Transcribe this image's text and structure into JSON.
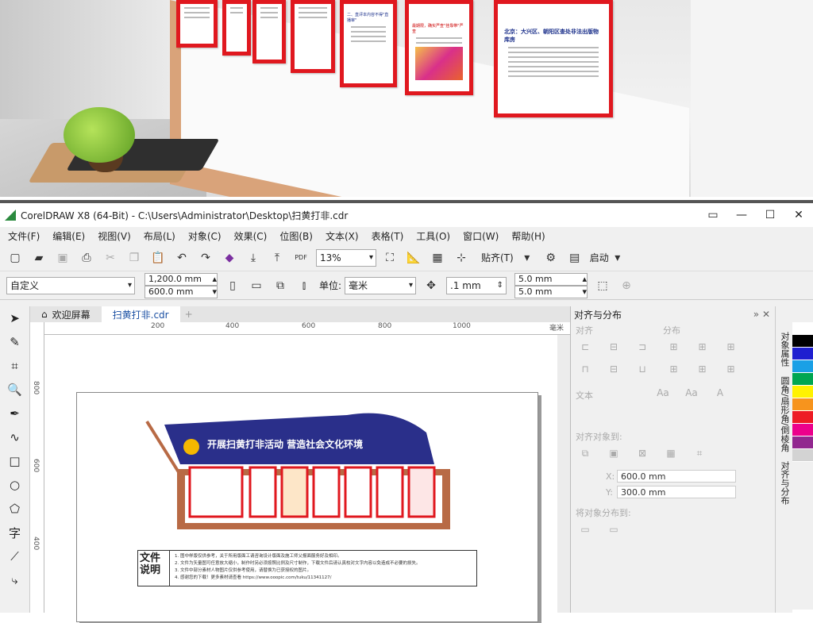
{
  "photo": {
    "panel_headlines": [
      "二、直评本内容不得\"直播审\"",
      "最期限，确实严查\"挂靠带\"严查",
      "北京：大兴区、朝阳区查处非法出版物库房"
    ]
  },
  "app": {
    "title": "CorelDRAW X8 (64-Bit) - C:\\Users\\Administrator\\Desktop\\扫黄打非.cdr",
    "window_buttons": [
      "▭",
      "—",
      "☐",
      "✕"
    ],
    "menu": [
      "文件(F)",
      "编辑(E)",
      "视图(V)",
      "布局(L)",
      "对象(C)",
      "效果(C)",
      "位图(B)",
      "文本(X)",
      "表格(T)",
      "工具(O)",
      "窗口(W)",
      "帮助(H)"
    ],
    "toolbar": {
      "zoom": "13%",
      "snap_label": "贴齐(T)",
      "launch_label": "启动",
      "pdf_label": "PDF"
    },
    "propbar": {
      "page_preset": "自定义",
      "width": "1,200.0 mm",
      "height": "600.0 mm",
      "unit_label": "单位:",
      "unit": "毫米",
      "nudge": ".1 mm",
      "dup_x": "5.0 mm",
      "dup_y": "5.0 mm"
    },
    "doc_tabs": [
      "欢迎屏幕",
      "扫黄打非.cdr"
    ],
    "ruler": {
      "h_ticks": [
        "200",
        "400",
        "600",
        "800",
        "1000"
      ],
      "h_unit": "毫米",
      "v_ticks": [
        "800",
        "600",
        "400"
      ]
    },
    "design": {
      "headline": "开展扫黄打非活动 营造社会文化环境",
      "notes_title": "文件说明",
      "notes_lines": [
        "1. 图中样版仅供参考，关于所用版面工请咨询设计版面及施工师父报面服务好及相印。",
        "2. 文件为矢量图可任意放大缩小，制作时另必须按照比例及尺寸制作，下载文件后请认真校对文字内容以免造成不必要的损失。",
        "3. 文件中部分素材人物图片仅供参考使用，请替换为已获授权的图片。",
        "4. 感谢您的下载！更多素材请查看  https://www.ooopic.com/tuku/11341127/"
      ]
    },
    "dock": {
      "title": "对齐与分布",
      "sec_align": "对齐",
      "sec_dist": "分布",
      "sec_text": "文本",
      "sec_align_to": "对齐对象到:",
      "sec_dist_to": "将对象分布到:",
      "x_value": "600.0 mm",
      "y_value": "300.0 mm",
      "x_label": "X:",
      "y_label": "Y:"
    },
    "right_tabs": [
      "对象属性",
      "圆角/扇形角/倒棱角",
      "对齐与分布"
    ],
    "palette": [
      "#ffffff",
      "#000000",
      "#1f1fd0",
      "#1aa0e6",
      "#00a651",
      "#fff200",
      "#f7941d",
      "#ed1c24",
      "#ec008c",
      "#92278f",
      "#d3d3d3"
    ]
  }
}
